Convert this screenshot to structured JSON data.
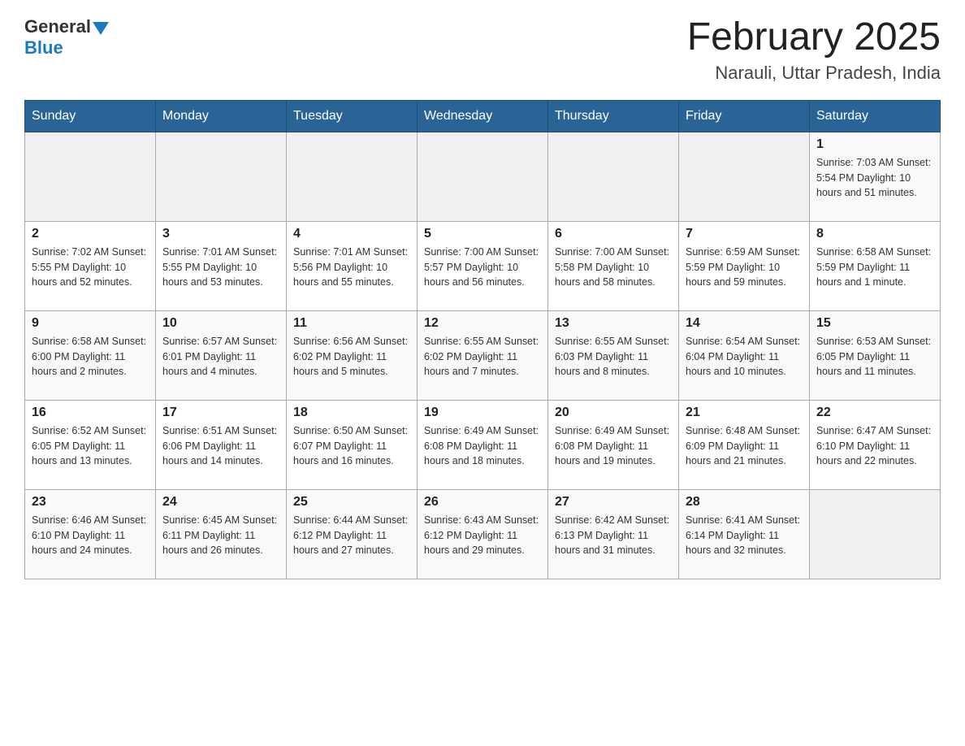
{
  "header": {
    "logo_general": "General",
    "logo_blue": "Blue",
    "month_title": "February 2025",
    "location": "Narauli, Uttar Pradesh, India"
  },
  "days_of_week": [
    "Sunday",
    "Monday",
    "Tuesday",
    "Wednesday",
    "Thursday",
    "Friday",
    "Saturday"
  ],
  "weeks": [
    {
      "days": [
        {
          "num": "",
          "info": ""
        },
        {
          "num": "",
          "info": ""
        },
        {
          "num": "",
          "info": ""
        },
        {
          "num": "",
          "info": ""
        },
        {
          "num": "",
          "info": ""
        },
        {
          "num": "",
          "info": ""
        },
        {
          "num": "1",
          "info": "Sunrise: 7:03 AM\nSunset: 5:54 PM\nDaylight: 10 hours\nand 51 minutes."
        }
      ]
    },
    {
      "days": [
        {
          "num": "2",
          "info": "Sunrise: 7:02 AM\nSunset: 5:55 PM\nDaylight: 10 hours\nand 52 minutes."
        },
        {
          "num": "3",
          "info": "Sunrise: 7:01 AM\nSunset: 5:55 PM\nDaylight: 10 hours\nand 53 minutes."
        },
        {
          "num": "4",
          "info": "Sunrise: 7:01 AM\nSunset: 5:56 PM\nDaylight: 10 hours\nand 55 minutes."
        },
        {
          "num": "5",
          "info": "Sunrise: 7:00 AM\nSunset: 5:57 PM\nDaylight: 10 hours\nand 56 minutes."
        },
        {
          "num": "6",
          "info": "Sunrise: 7:00 AM\nSunset: 5:58 PM\nDaylight: 10 hours\nand 58 minutes."
        },
        {
          "num": "7",
          "info": "Sunrise: 6:59 AM\nSunset: 5:59 PM\nDaylight: 10 hours\nand 59 minutes."
        },
        {
          "num": "8",
          "info": "Sunrise: 6:58 AM\nSunset: 5:59 PM\nDaylight: 11 hours\nand 1 minute."
        }
      ]
    },
    {
      "days": [
        {
          "num": "9",
          "info": "Sunrise: 6:58 AM\nSunset: 6:00 PM\nDaylight: 11 hours\nand 2 minutes."
        },
        {
          "num": "10",
          "info": "Sunrise: 6:57 AM\nSunset: 6:01 PM\nDaylight: 11 hours\nand 4 minutes."
        },
        {
          "num": "11",
          "info": "Sunrise: 6:56 AM\nSunset: 6:02 PM\nDaylight: 11 hours\nand 5 minutes."
        },
        {
          "num": "12",
          "info": "Sunrise: 6:55 AM\nSunset: 6:02 PM\nDaylight: 11 hours\nand 7 minutes."
        },
        {
          "num": "13",
          "info": "Sunrise: 6:55 AM\nSunset: 6:03 PM\nDaylight: 11 hours\nand 8 minutes."
        },
        {
          "num": "14",
          "info": "Sunrise: 6:54 AM\nSunset: 6:04 PM\nDaylight: 11 hours\nand 10 minutes."
        },
        {
          "num": "15",
          "info": "Sunrise: 6:53 AM\nSunset: 6:05 PM\nDaylight: 11 hours\nand 11 minutes."
        }
      ]
    },
    {
      "days": [
        {
          "num": "16",
          "info": "Sunrise: 6:52 AM\nSunset: 6:05 PM\nDaylight: 11 hours\nand 13 minutes."
        },
        {
          "num": "17",
          "info": "Sunrise: 6:51 AM\nSunset: 6:06 PM\nDaylight: 11 hours\nand 14 minutes."
        },
        {
          "num": "18",
          "info": "Sunrise: 6:50 AM\nSunset: 6:07 PM\nDaylight: 11 hours\nand 16 minutes."
        },
        {
          "num": "19",
          "info": "Sunrise: 6:49 AM\nSunset: 6:08 PM\nDaylight: 11 hours\nand 18 minutes."
        },
        {
          "num": "20",
          "info": "Sunrise: 6:49 AM\nSunset: 6:08 PM\nDaylight: 11 hours\nand 19 minutes."
        },
        {
          "num": "21",
          "info": "Sunrise: 6:48 AM\nSunset: 6:09 PM\nDaylight: 11 hours\nand 21 minutes."
        },
        {
          "num": "22",
          "info": "Sunrise: 6:47 AM\nSunset: 6:10 PM\nDaylight: 11 hours\nand 22 minutes."
        }
      ]
    },
    {
      "days": [
        {
          "num": "23",
          "info": "Sunrise: 6:46 AM\nSunset: 6:10 PM\nDaylight: 11 hours\nand 24 minutes."
        },
        {
          "num": "24",
          "info": "Sunrise: 6:45 AM\nSunset: 6:11 PM\nDaylight: 11 hours\nand 26 minutes."
        },
        {
          "num": "25",
          "info": "Sunrise: 6:44 AM\nSunset: 6:12 PM\nDaylight: 11 hours\nand 27 minutes."
        },
        {
          "num": "26",
          "info": "Sunrise: 6:43 AM\nSunset: 6:12 PM\nDaylight: 11 hours\nand 29 minutes."
        },
        {
          "num": "27",
          "info": "Sunrise: 6:42 AM\nSunset: 6:13 PM\nDaylight: 11 hours\nand 31 minutes."
        },
        {
          "num": "28",
          "info": "Sunrise: 6:41 AM\nSunset: 6:14 PM\nDaylight: 11 hours\nand 32 minutes."
        },
        {
          "num": "",
          "info": ""
        }
      ]
    }
  ]
}
